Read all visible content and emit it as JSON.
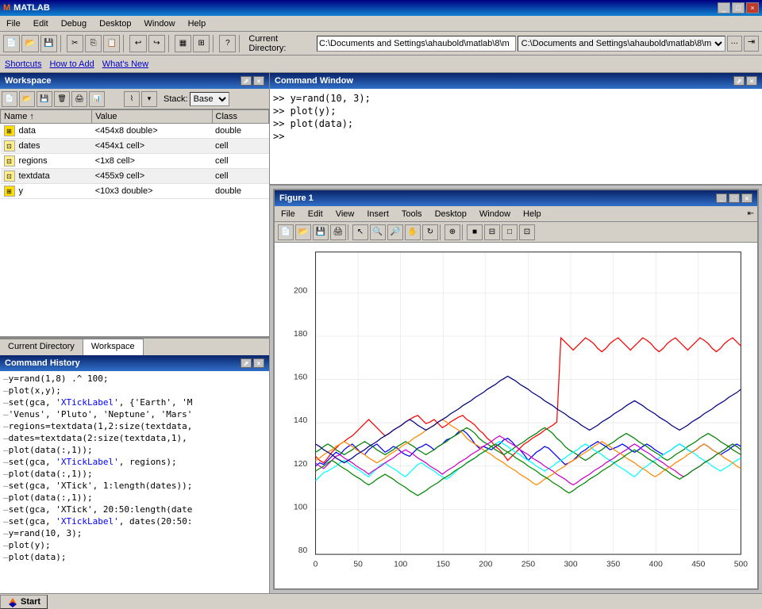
{
  "app": {
    "title": "MATLAB",
    "logo": "M"
  },
  "title_bar": {
    "title": "MATLAB",
    "buttons": [
      "_",
      "□",
      "×"
    ]
  },
  "menu_bar": {
    "items": [
      "File",
      "Edit",
      "Debug",
      "Desktop",
      "Window",
      "Help"
    ]
  },
  "toolbar": {
    "current_dir_label": "Current Directory:",
    "current_dir_value": "C:\\Documents and Settings\\ahaubold\\matlab\\8\\m",
    "buttons": [
      "new",
      "open",
      "cut",
      "copy",
      "paste",
      "undo",
      "redo",
      "simulink",
      "guide",
      "help"
    ]
  },
  "shortcuts_bar": {
    "items": [
      "Shortcuts",
      "How to Add",
      "What's New"
    ]
  },
  "workspace": {
    "title": "Workspace",
    "toolbar": {
      "stack_label": "Stack:",
      "stack_value": "Base"
    },
    "columns": [
      "Name",
      "Value",
      "Class"
    ],
    "rows": [
      {
        "name": "data",
        "value": "<454x8 double>",
        "class": "double",
        "icon": "grid"
      },
      {
        "name": "dates",
        "value": "<454x1 cell>",
        "class": "cell",
        "icon": "cell"
      },
      {
        "name": "regions",
        "value": "<1x8 cell>",
        "class": "cell",
        "icon": "cell"
      },
      {
        "name": "textdata",
        "value": "<455x9 cell>",
        "class": "cell",
        "icon": "cell"
      },
      {
        "name": "y",
        "value": "<10x3 double>",
        "class": "double",
        "icon": "grid"
      }
    ]
  },
  "tabs": {
    "current_directory": "Current Directory",
    "workspace": "Workspace"
  },
  "command_history": {
    "title": "Command History",
    "lines": [
      "y=rand(1,8) .^ 100;",
      "plot(x,y);",
      "set(gca, 'XTickLabel', {'Earth', 'M",
      "'Venus', 'Pluto', 'Neptune', 'Mars'",
      "regions=textdata(1,2:size(textdata,",
      "dates=textdata(2:size(textdata,1),",
      "plot(data(:,1));",
      "set(gca, 'XTickLabel', regions);",
      "plot(data(:,1));",
      "set(gca, 'XTick', 1:length(dates));",
      "plot(data(:,1));",
      "set(gca, 'XTick', 20:50:length(date",
      "set(gca, 'XTickLabel', dates(20:50:",
      "y=rand(10, 3);",
      "plot(y);",
      "plot(data);"
    ]
  },
  "command_window": {
    "title": "Command Window",
    "lines": [
      ">> y=rand(10, 3);",
      ">> plot(y);",
      ">> plot(data);",
      ">>"
    ]
  },
  "figure": {
    "title": "Figure 1",
    "menu": [
      "File",
      "Edit",
      "View",
      "Insert",
      "Tools",
      "Desktop",
      "Window",
      "Help"
    ],
    "y_axis": {
      "max": 200,
      "ticks": [
        80,
        100,
        120,
        140,
        160,
        180,
        200
      ]
    },
    "x_axis": {
      "max": 500,
      "ticks": [
        0,
        50,
        100,
        150,
        200,
        250,
        300,
        350,
        400,
        450,
        500
      ]
    }
  },
  "taskbar": {
    "start_label": "Start"
  }
}
